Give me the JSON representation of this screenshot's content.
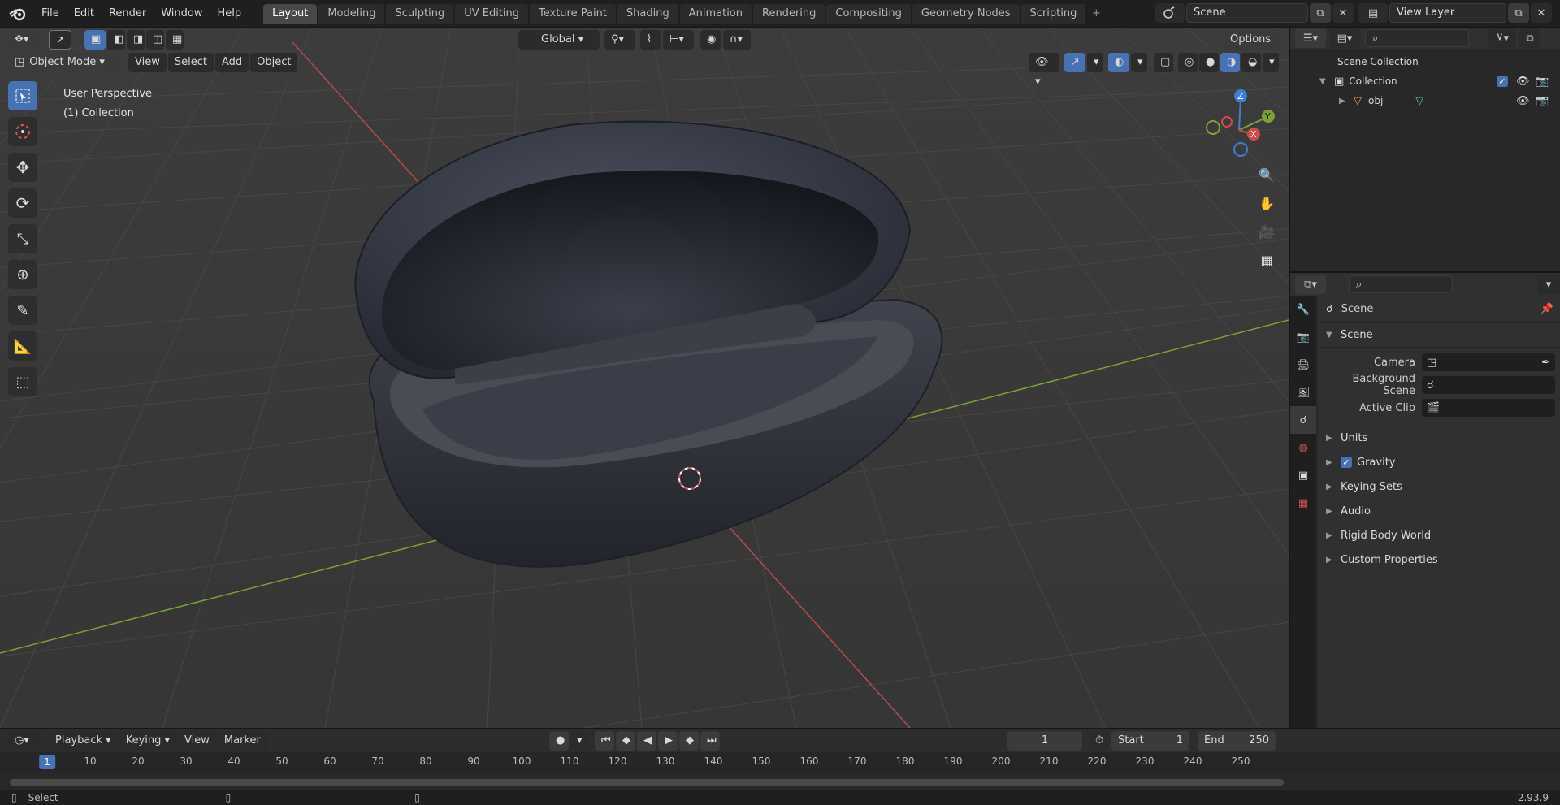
{
  "topbar": {
    "menu": [
      "File",
      "Edit",
      "Render",
      "Window",
      "Help"
    ],
    "workspaces": [
      "Layout",
      "Modeling",
      "Sculpting",
      "UV Editing",
      "Texture Paint",
      "Shading",
      "Animation",
      "Rendering",
      "Compositing",
      "Geometry Nodes",
      "Scripting"
    ],
    "active_workspace": "Layout",
    "scene_name": "Scene",
    "view_layer": "View Layer"
  },
  "viewport": {
    "mode": "Object Mode",
    "header_menus": [
      "View",
      "Select",
      "Add",
      "Object"
    ],
    "transform_orientation": "Global",
    "options_label": "Options",
    "view_name": "User Perspective",
    "collection_label": "(1) Collection",
    "colors": {
      "x_axis": "#b84a4a",
      "y_axis": "#7aa336",
      "z_axis": "#3f7fd1",
      "grid": "#444444",
      "bg": "#3a3a3a"
    }
  },
  "outliner": {
    "root": "Scene Collection",
    "collection": "Collection",
    "object": "obj"
  },
  "properties": {
    "context_label": "Scene",
    "panel_title": "Scene",
    "camera_label": "Camera",
    "background_scene_label": "Background Scene",
    "active_clip_label": "Active Clip",
    "sections": [
      "Units",
      "Gravity",
      "Keying Sets",
      "Audio",
      "Rigid Body World",
      "Custom Properties"
    ]
  },
  "timeline": {
    "menus": [
      "Playback",
      "Keying",
      "View",
      "Marker"
    ],
    "current_frame": "1",
    "start_label": "Start",
    "start_value": "1",
    "end_label": "End",
    "end_value": "250",
    "ruler_ticks": [
      "10",
      "20",
      "30",
      "40",
      "50",
      "60",
      "70",
      "80",
      "90",
      "100",
      "110",
      "120",
      "130",
      "140",
      "150",
      "160",
      "170",
      "180",
      "190",
      "200",
      "210",
      "220",
      "230",
      "240",
      "250"
    ],
    "ruler_current": "1"
  },
  "status": {
    "left_label": "Select",
    "version": "2.93.9"
  }
}
